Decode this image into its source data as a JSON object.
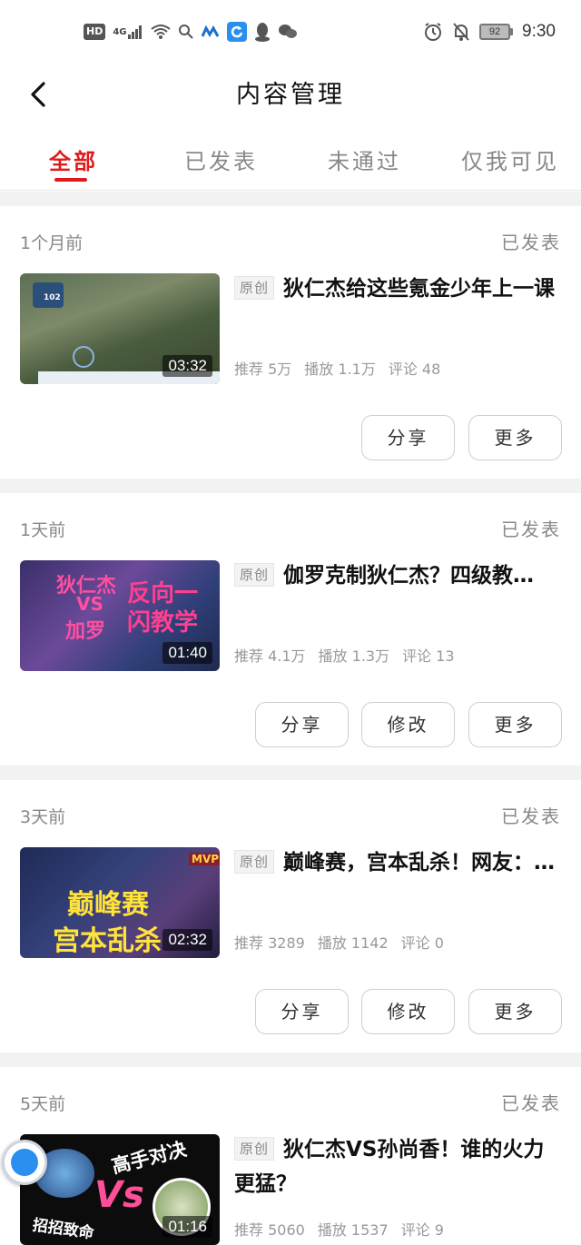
{
  "statusbar": {
    "hd": "HD",
    "net": "4G",
    "battery": "92",
    "time": "9:30"
  },
  "header": {
    "title": "内容管理"
  },
  "tabs": [
    {
      "label": "全部",
      "active": true
    },
    {
      "label": "已发表",
      "active": false
    },
    {
      "label": "未通过",
      "active": false
    },
    {
      "label": "仅我可见",
      "active": false
    }
  ],
  "colors": {
    "accent": "#e0191b",
    "muted": "#888888",
    "divider": "#f2f2f2"
  },
  "items": [
    {
      "when": "1个月前",
      "status": "已发表",
      "tag": "原创",
      "title": "狄仁杰给这些氪金少年上一课",
      "duration": "03:32",
      "stats": {
        "recommend": "推荐 5万",
        "play": "播放 1.1万",
        "comment": "评论 48"
      },
      "thumb_text": [
        "102"
      ],
      "buttons": [
        "分享",
        "更多"
      ]
    },
    {
      "when": "1天前",
      "status": "已发表",
      "tag": "原创",
      "title": "伽罗克制狄仁杰？四级教…",
      "duration": "01:40",
      "stats": {
        "recommend": "推荐 4.1万",
        "play": "播放 1.3万",
        "comment": "评论 13"
      },
      "thumb_text": [
        "狄仁杰",
        "VS",
        "加罗",
        "反向一",
        "闪教学"
      ],
      "buttons": [
        "分享",
        "修改",
        "更多"
      ]
    },
    {
      "when": "3天前",
      "status": "已发表",
      "tag": "原创",
      "title": "巅峰赛，宫本乱杀！网友：…",
      "duration": "02:32",
      "stats": {
        "recommend": "推荐 3289",
        "play": "播放 1142",
        "comment": "评论 0"
      },
      "thumb_text": [
        "巅峰赛",
        "宫本乱杀",
        "MVP"
      ],
      "buttons": [
        "分享",
        "修改",
        "更多"
      ]
    },
    {
      "when": "5天前",
      "status": "已发表",
      "tag": "原创",
      "title": "狄仁杰VS孙尚香！谁的火力更猛？",
      "duration": "01:16",
      "stats": {
        "recommend": "推荐 5060",
        "play": "播放 1537",
        "comment": "评论 9"
      },
      "thumb_text": [
        "高手对决",
        "Vs",
        "招招致命"
      ],
      "buttons": []
    }
  ]
}
